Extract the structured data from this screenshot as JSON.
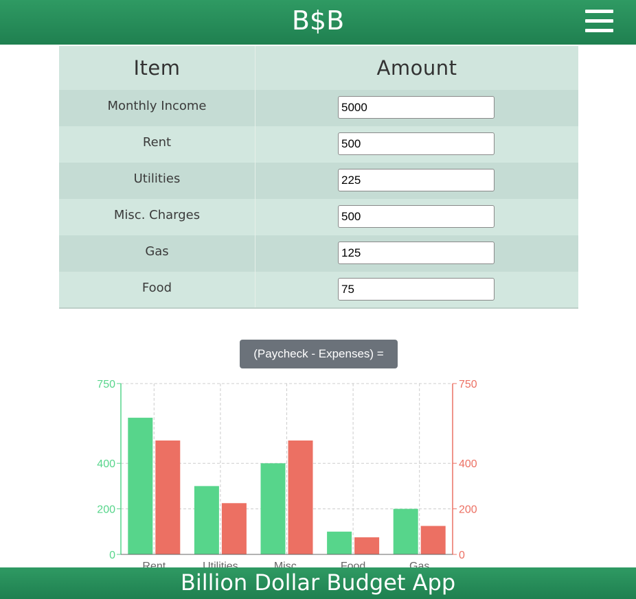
{
  "header": {
    "brand": "B$B",
    "menu_icon": "hamburger-menu-icon"
  },
  "table": {
    "headers": [
      "Item",
      "Amount"
    ],
    "rows": [
      {
        "label": "Monthly Income",
        "value": "5000"
      },
      {
        "label": "Rent",
        "value": "500"
      },
      {
        "label": "Utilities",
        "value": "225"
      },
      {
        "label": "Misc. Charges",
        "value": "500"
      },
      {
        "label": "Gas",
        "value": "125"
      },
      {
        "label": "Food",
        "value": "75"
      }
    ]
  },
  "calc_button": {
    "label": "(Paycheck - Expenses) ="
  },
  "chart_data": {
    "type": "bar",
    "categories": [
      "Rent",
      "Utilities",
      "Misc.",
      "Food",
      "Gas"
    ],
    "series": [
      {
        "values": [
          600,
          300,
          400,
          100,
          200
        ],
        "color": "#57d58b",
        "axis": "left"
      },
      {
        "values": [
          500,
          225,
          500,
          75,
          125
        ],
        "color": "#ec7063",
        "axis": "right"
      }
    ],
    "yticks_left": [
      0,
      200,
      400,
      750
    ],
    "yticks_right": [
      0,
      200,
      400,
      750
    ],
    "ylim": [
      0,
      750
    ],
    "left_axis_color": "#57d58b",
    "right_axis_color": "#ec7063",
    "grid": true
  },
  "footer": {
    "title": "Billion Dollar Budget App"
  }
}
